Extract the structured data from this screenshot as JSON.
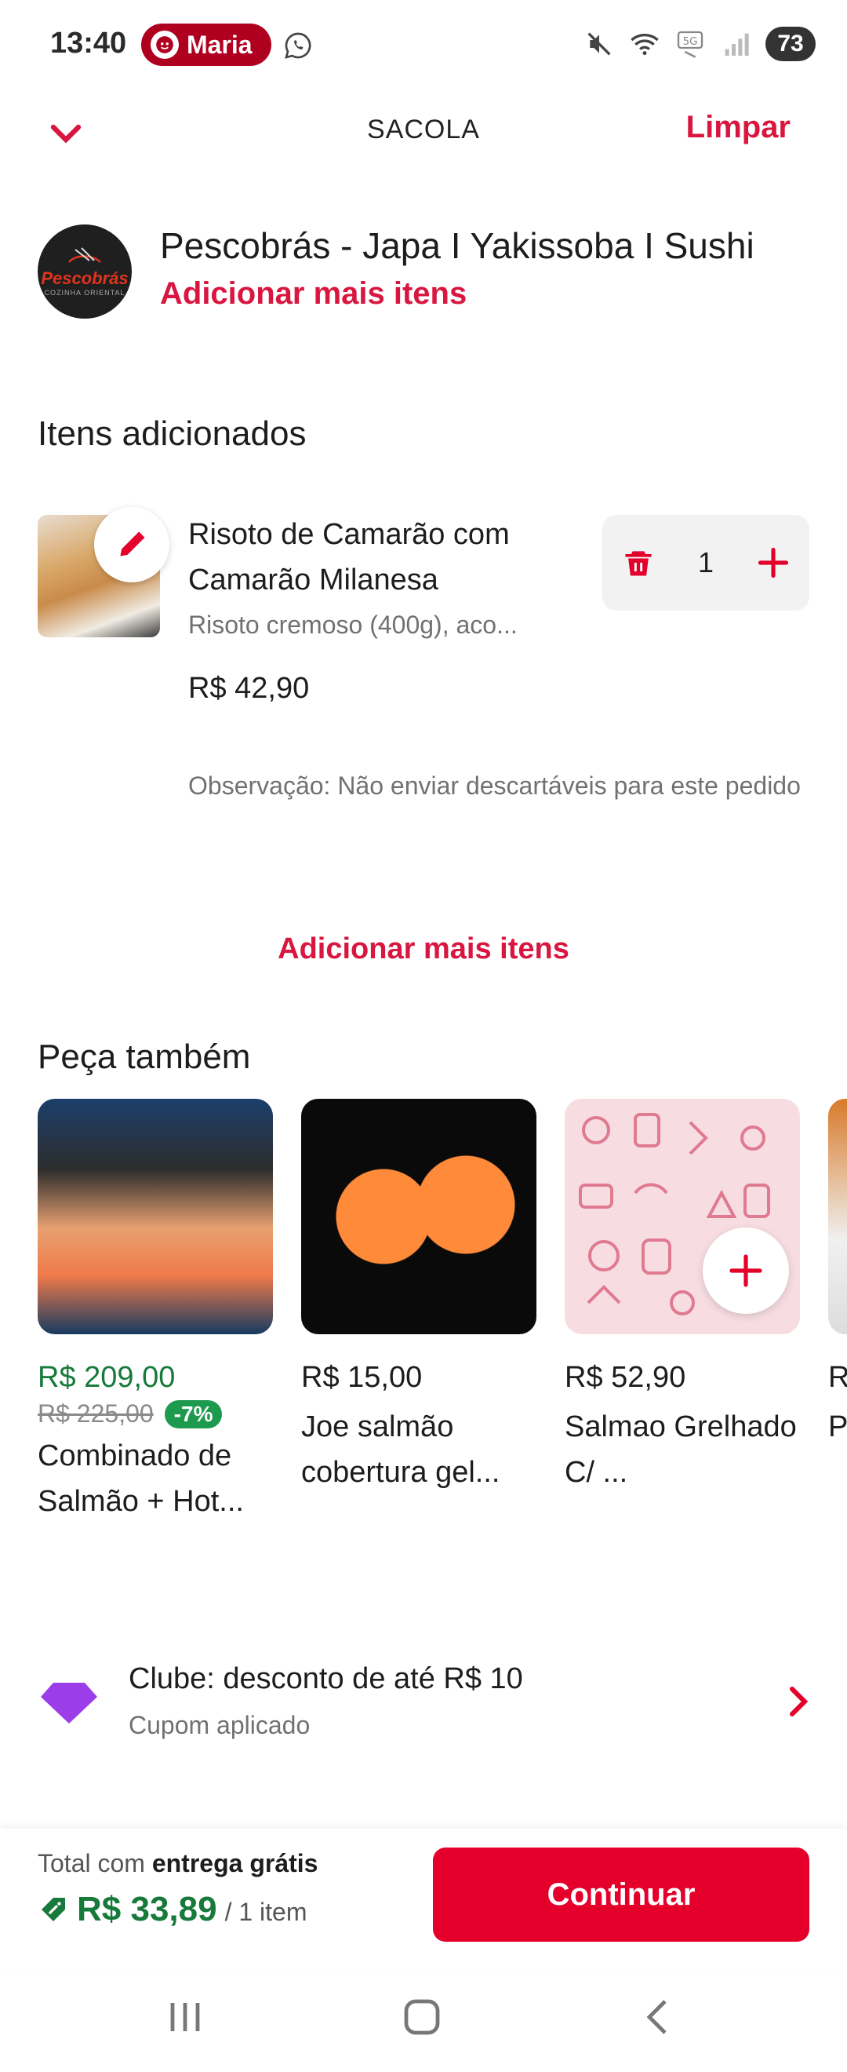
{
  "status_bar": {
    "time": "13:40",
    "profile_name": "Maria",
    "battery": "73",
    "icons": [
      "whatsapp-icon",
      "mute-icon",
      "wifi-icon",
      "5g-icon",
      "signal-icon"
    ]
  },
  "header": {
    "title": "SACOLA",
    "clear_label": "Limpar",
    "back_icon": "chevron-down-icon"
  },
  "restaurant": {
    "name": "Pescobrás - Japa I Yakissoba I Sushi",
    "add_more": "Adicionar mais itens",
    "logo_text": "Pescobrás",
    "logo_subtext": "COZINHA ORIENTAL"
  },
  "cart": {
    "section_title": "Itens adicionados",
    "items": [
      {
        "name": "Risoto de Camarão com Camarão Milanesa",
        "description": "Risoto cremoso (400g), aco...",
        "price": "R$ 42,90",
        "quantity": "1",
        "note": "Observação: Não enviar descartáveis para este pedido"
      }
    ],
    "add_more": "Adicionar mais itens"
  },
  "suggestions": {
    "title": "Peça também",
    "items": [
      {
        "price": "R$ 209,00",
        "old_price": "R$ 225,00",
        "discount": "-7%",
        "name": "Combinado de Salmão + Hot..."
      },
      {
        "price": "R$ 15,00",
        "name": "Joe salmão cobertura gel..."
      },
      {
        "price": "R$ 52,90",
        "name": "Salmao Grelhado C/ ..."
      },
      {
        "price": "R",
        "name": "P D"
      }
    ]
  },
  "club": {
    "title": "Clube: desconto de até R$ 10",
    "subtitle": "Cupom aplicado"
  },
  "footer": {
    "total_prefix": "Total com",
    "total_bold": "entrega grátis",
    "total_value": "R$ 33,89",
    "total_count": "/ 1 item",
    "continue_label": "Continuar"
  },
  "colors": {
    "brand_red": "#e4002b",
    "link_red": "#d8163f",
    "discount_green": "#177a3b",
    "club_purple": "#9b3de8"
  }
}
